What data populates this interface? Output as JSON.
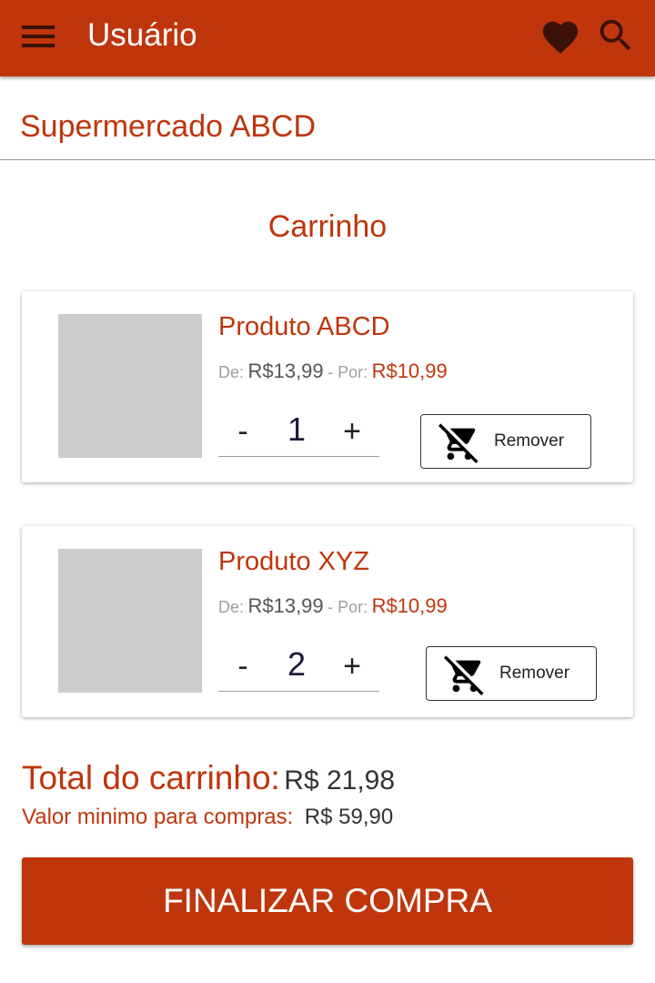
{
  "appbar": {
    "title": "Usuário",
    "icons": {
      "menu": "menu-icon",
      "favorite": "heart-icon",
      "search": "search-icon"
    }
  },
  "store": {
    "name": "Supermercado ABCD"
  },
  "cart": {
    "title": "Carrinho",
    "items": [
      {
        "name": "Produto ABCD",
        "price_from_label": "De:",
        "price_from": "R$13,99",
        "price_separator": "- Por:",
        "price_to": "R$10,99",
        "minus": "-",
        "quantity": "1",
        "plus": "+",
        "remove_label": "Remover"
      },
      {
        "name": "Produto XYZ",
        "price_from_label": "De:",
        "price_from": "R$13,99",
        "price_separator": "- Por:",
        "price_to": "R$10,99",
        "minus": "-",
        "quantity": "2",
        "plus": "+",
        "remove_label": "Remover"
      }
    ],
    "total_label": "Total do carrinho:",
    "total_value": "R$ 21,98",
    "min_label": "Valor minimo para compras:",
    "min_value": "R$ 59,90",
    "checkout_label": "FINALIZAR COMPRA"
  },
  "colors": {
    "primary": "#bf360c",
    "placeholder": "#cccccc"
  }
}
